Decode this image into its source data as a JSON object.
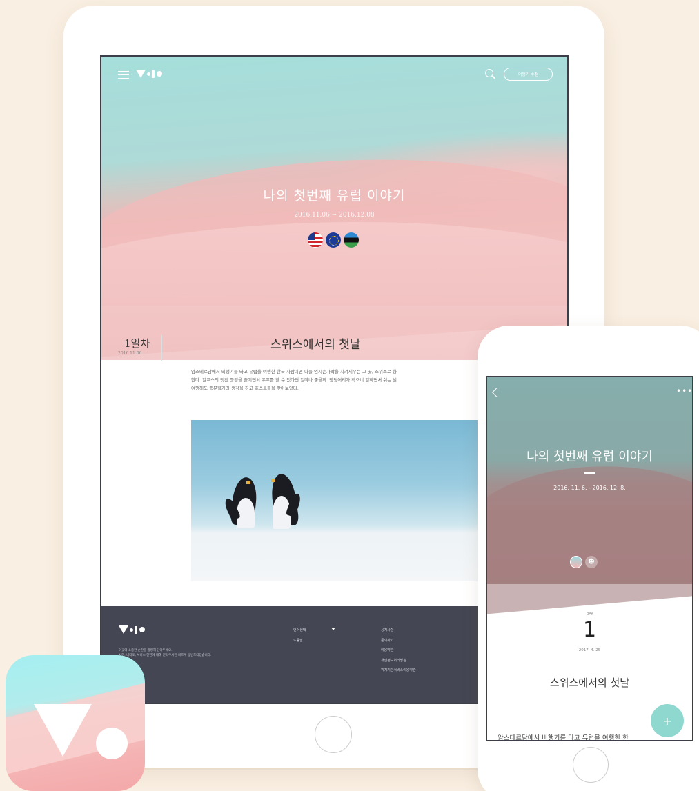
{
  "tablet": {
    "nav": {
      "menu_icon": "hamburger-icon",
      "search_icon": "search-icon",
      "edit_button_label": "여행기 수정"
    },
    "hero": {
      "title": "나의 첫번째 유럽 이야기",
      "dates": "2016.11.06 ~ 2016.12.08",
      "flags": [
        "us-flag-icon",
        "eu-flag-icon",
        "estonia-flag-icon"
      ]
    },
    "post": {
      "day_label": "1일차",
      "day_date": "2016.11.06",
      "title": "스위스에서의 첫날",
      "body": [
        "암스테르담에서 비행기를 타고 유럽을 여행한 한국 사람이면 다들 엄지손가락을 치켜세우는 그 곳, 스위스로 향",
        "한다. 알프스의 멋진 풍경을 즐기면서 우프를 할 수 있다면 얼마나 좋을까. 망딩어리가 작으니 일하면서 쉬는 날",
        "여행해도 충분할거라 생각을 하고 호스트들을 찾아보았다."
      ]
    },
    "footer": {
      "address": [
        "이곳에 소중한 순간을 촬영해 담아두세요.",
        "사진, 비디오, 서비스 전반에 대해 문의주시면 빠르게 답변드리겠습니다."
      ],
      "col_a": [
        "언어선택",
        "도움말"
      ],
      "col_b": [
        "공지사항",
        "문의하기",
        "이용약관",
        "개인정보처리방침",
        "위치기반서비스이용약관"
      ]
    }
  },
  "phone": {
    "hero": {
      "title": "나의 첫번째 유럽 이야기",
      "dates": "2016. 11. 6. - 2016. 12. 8.",
      "add_user_icon": "add-user-icon"
    },
    "day_label": "DAY",
    "day_number": "1",
    "day_date": "2017. 4. 25",
    "post_title": "스위스에서의 첫날",
    "body_preview": "암스테르담에서 비행기를 타고 유럽을 여행한 한",
    "fab_label": "+"
  },
  "colors": {
    "background": "#f9efe2",
    "hero_teal": "#a5dedb",
    "hero_pink": "#efb6b6",
    "footer": "#444653",
    "fab": "#8fd8d0"
  }
}
